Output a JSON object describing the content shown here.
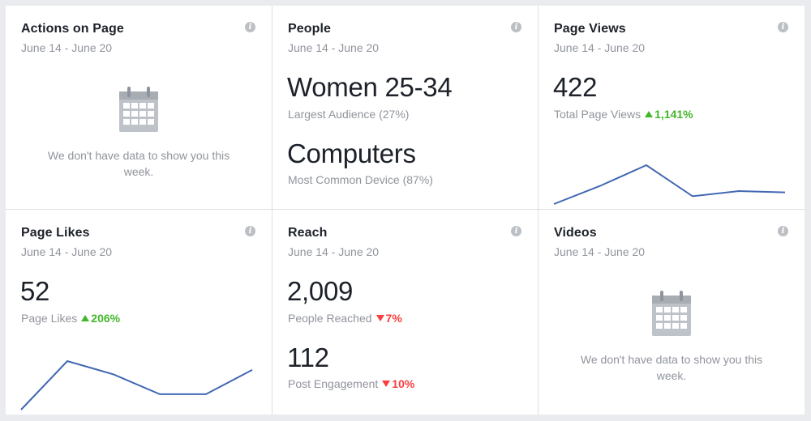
{
  "colors": {
    "accent": "#4267b2",
    "up": "#42b72a",
    "down": "#fa3e3e",
    "muted": "#90949c"
  },
  "cards": {
    "actions": {
      "title": "Actions on Page",
      "date": "June 14 - June 20",
      "icon": "calendar-icon",
      "empty_text": "We don't have data to show you this week."
    },
    "people": {
      "title": "People",
      "date": "June 14 - June 20",
      "primary_value": "Women 25-34",
      "primary_label": "Largest Audience (27%)",
      "secondary_value": "Computers",
      "secondary_label": "Most Common Device (87%)"
    },
    "page_views": {
      "title": "Page Views",
      "date": "June 14 - June 20",
      "value": "422",
      "label": "Total Page Views",
      "change": "1,141%",
      "trend": "up",
      "sparkline": [
        5,
        12,
        20,
        8,
        10,
        9.5
      ]
    },
    "page_likes": {
      "title": "Page Likes",
      "date": "June 14 - June 20",
      "value": "52",
      "label": "Page Likes",
      "change": "206%",
      "trend": "up",
      "sparkline": [
        4,
        15,
        12,
        7.5,
        7.5,
        13
      ]
    },
    "reach": {
      "title": "Reach",
      "date": "June 14 - June 20",
      "value": "2,009",
      "label": "People Reached",
      "change": "7%",
      "trend": "down",
      "value2": "112",
      "label2": "Post Engagement",
      "change2": "10%",
      "trend2": "down"
    },
    "videos": {
      "title": "Videos",
      "date": "June 14 - June 20",
      "icon": "calendar-icon",
      "empty_text": "We don't have data to show you this week."
    }
  }
}
